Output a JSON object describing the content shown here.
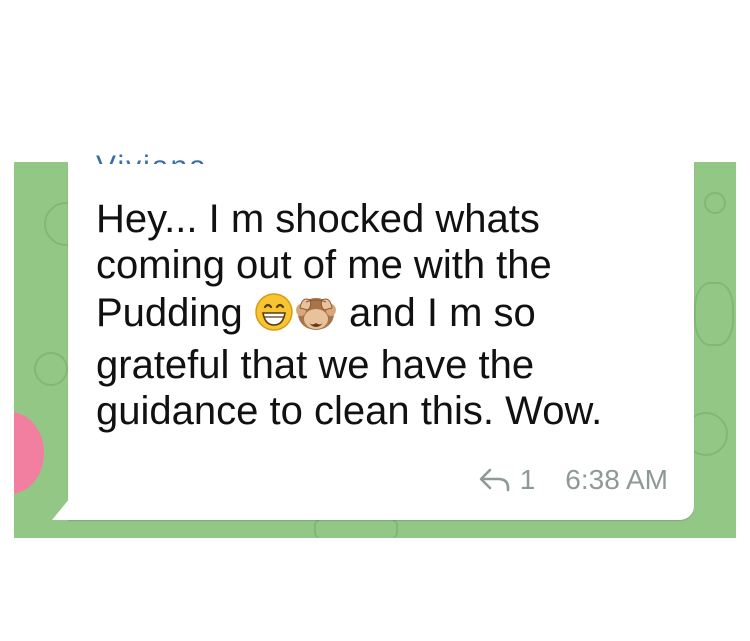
{
  "message": {
    "sender": "Viviana",
    "lines": [
      "Hey... I m shocked whats",
      "coming out of me with the",
      "Pudding",
      "and I m so",
      "grateful that we have the",
      "guidance to clean this. Wow."
    ],
    "emojis": [
      "grinning-face-icon",
      "see-no-evil-monkey-icon"
    ],
    "reply_count": "1",
    "time": "6:38 AM"
  },
  "colors": {
    "chat_background": "#93c786",
    "bubble": "#ffffff",
    "sender_name": "#3a6ea5",
    "meta_text": "#8e9a96",
    "avatar": "#f27fa0"
  }
}
